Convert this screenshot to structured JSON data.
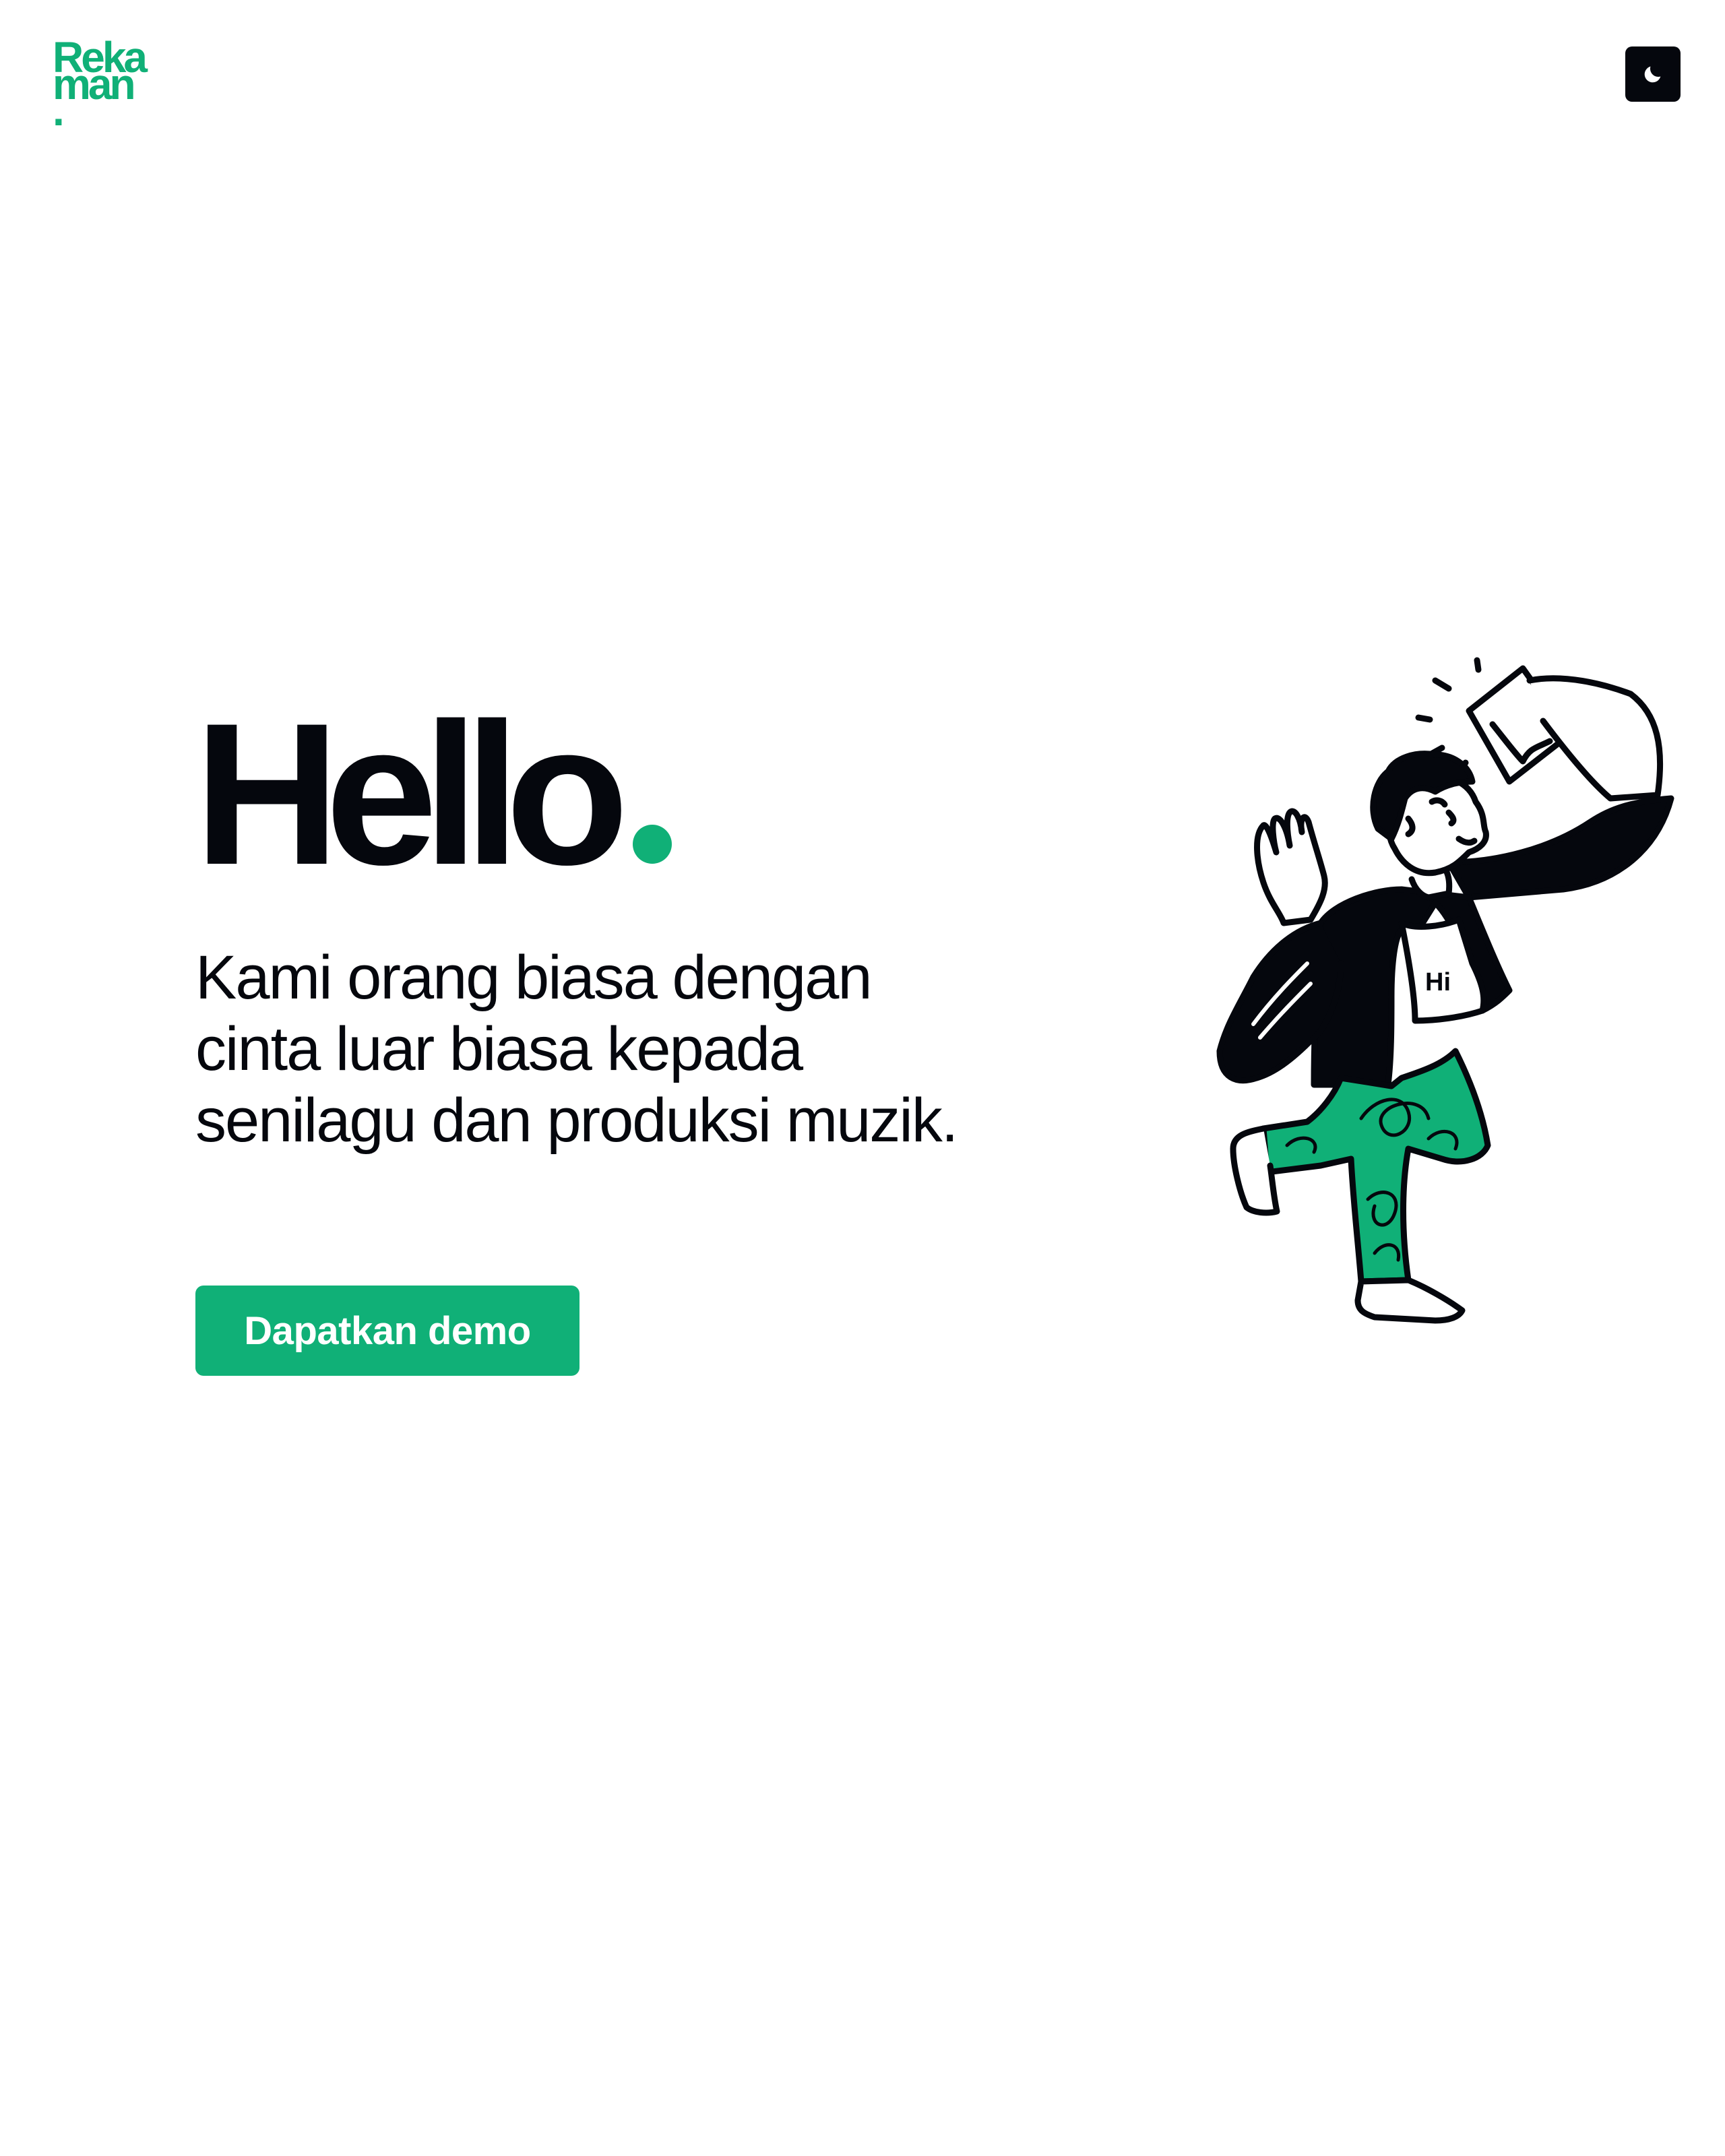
{
  "header": {
    "logo_line1": "Reka",
    "logo_line2": "man",
    "logo_dot": ".",
    "theme_toggle_icon": "moon-icon"
  },
  "hero": {
    "title": "Hello",
    "description": "Kami orang biasa dengan cinta luar biasa kepada senilagu dan produksi muzik.",
    "cta_label": "Dapatkan demo",
    "illustration_shirt_text": "Hi"
  },
  "colors": {
    "brand_green": "#10b077",
    "ink": "#05070d",
    "background": "#ffffff"
  }
}
